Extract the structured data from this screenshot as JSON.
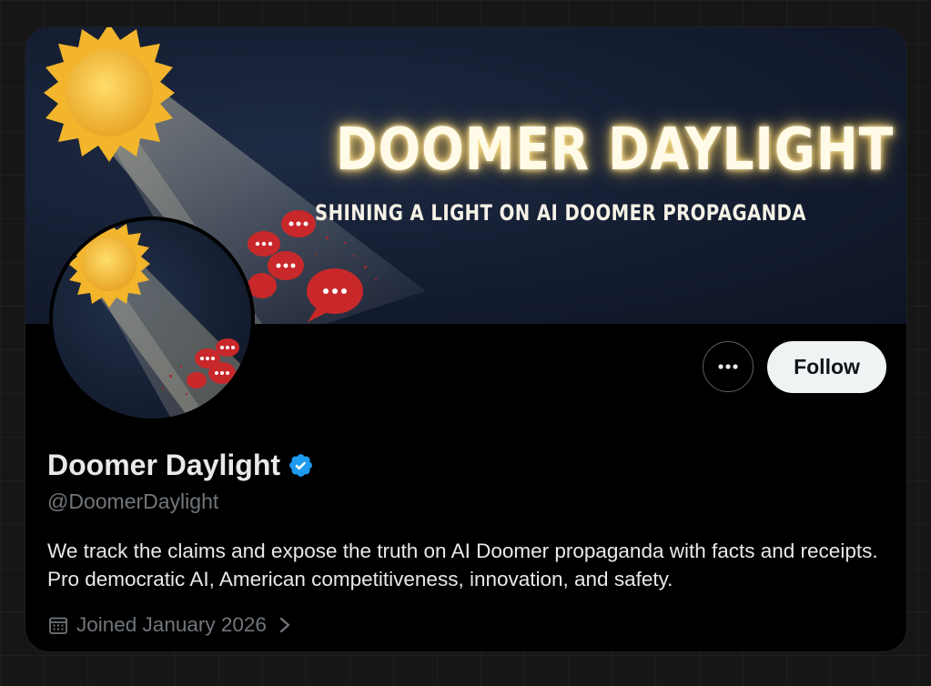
{
  "banner": {
    "title": "DOOMER DAYLIGHT",
    "subtitle": "SHINING A LIGHT ON AI DOOMER PROPAGANDA"
  },
  "profile": {
    "display_name": "Doomer Daylight",
    "verified": true,
    "handle": "@DoomerDaylight",
    "bio": "We track the claims and expose the truth on AI Doomer propaganda with facts and receipts. Pro democratic AI, American competitiveness, innovation, and safety.",
    "joined": "Joined January 2026"
  },
  "actions": {
    "more_label": "•••",
    "follow_label": "Follow"
  },
  "icons": {
    "verified": "verified-badge-icon",
    "calendar": "calendar-icon",
    "chevron": "chevron-right-icon",
    "more": "more-options-icon"
  },
  "colors": {
    "background": "#000000",
    "primary_text": "#e7e9ea",
    "secondary_text": "#71767b",
    "verified_blue": "#1d9bf0",
    "follow_button_bg": "#eff3f4",
    "follow_button_text": "#0f1419",
    "sun": "#f4bf3a",
    "speech_bubble": "#c8282a"
  }
}
